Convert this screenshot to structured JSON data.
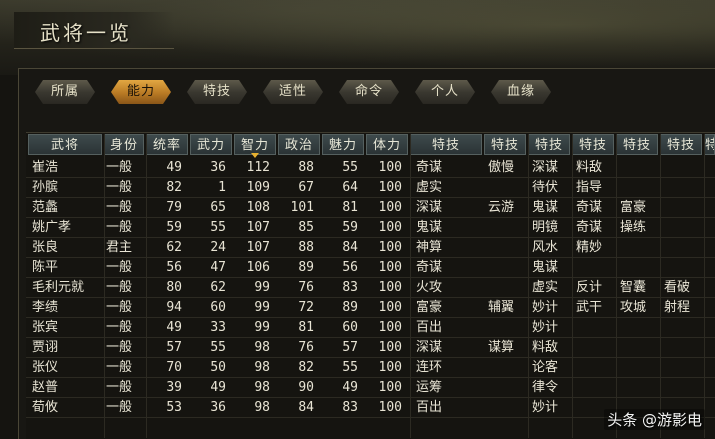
{
  "window": {
    "title": "武将一览"
  },
  "tabs": [
    {
      "label": "所属",
      "active": false
    },
    {
      "label": "能力",
      "active": true
    },
    {
      "label": "特技",
      "active": false
    },
    {
      "label": "适性",
      "active": false
    },
    {
      "label": "命令",
      "active": false
    },
    {
      "label": "个人",
      "active": false
    },
    {
      "label": "血缘",
      "active": false
    }
  ],
  "columns": [
    "武将",
    "身份",
    "统率",
    "武力",
    "智力",
    "政治",
    "魅力",
    "体力",
    "特技",
    "特技",
    "特技",
    "特技",
    "特技",
    "特技",
    "特"
  ],
  "sorted_column": "智力",
  "rows": [
    {
      "name": "崔浩",
      "rank": "一般",
      "lead": "49",
      "war": "36",
      "int": "112",
      "pol": "88",
      "cha": "55",
      "hp": "100",
      "skills": [
        "奇谋",
        "傲慢",
        "深谋",
        "料敌",
        "",
        "",
        ""
      ]
    },
    {
      "name": "孙膑",
      "rank": "一般",
      "lead": "82",
      "war": "1",
      "int": "109",
      "pol": "67",
      "cha": "64",
      "hp": "100",
      "skills": [
        "虚实",
        "",
        "待伏",
        "指导",
        "",
        "",
        ""
      ]
    },
    {
      "name": "范蠡",
      "rank": "一般",
      "lead": "79",
      "war": "65",
      "int": "108",
      "pol": "101",
      "cha": "81",
      "hp": "100",
      "skills": [
        "深谋",
        "云游",
        "鬼谋",
        "奇谋",
        "富豪",
        "",
        ""
      ]
    },
    {
      "name": "姚广孝",
      "rank": "一般",
      "lead": "59",
      "war": "55",
      "int": "107",
      "pol": "85",
      "cha": "59",
      "hp": "100",
      "skills": [
        "鬼谋",
        "",
        "明镜",
        "奇谋",
        "操练",
        "",
        ""
      ]
    },
    {
      "name": "张良",
      "rank": "君主",
      "lead": "62",
      "war": "24",
      "int": "107",
      "pol": "88",
      "cha": "84",
      "hp": "100",
      "skills": [
        "神算",
        "",
        "风水",
        "精妙",
        "",
        "",
        ""
      ]
    },
    {
      "name": "陈平",
      "rank": "一般",
      "lead": "56",
      "war": "47",
      "int": "106",
      "pol": "89",
      "cha": "56",
      "hp": "100",
      "skills": [
        "奇谋",
        "",
        "鬼谋",
        "",
        "",
        "",
        ""
      ]
    },
    {
      "name": "毛利元就",
      "rank": "一般",
      "lead": "80",
      "war": "62",
      "int": "99",
      "pol": "76",
      "cha": "83",
      "hp": "100",
      "skills": [
        "火攻",
        "",
        "虚实",
        "反计",
        "智囊",
        "看破",
        ""
      ]
    },
    {
      "name": "李绩",
      "rank": "一般",
      "lead": "94",
      "war": "60",
      "int": "99",
      "pol": "72",
      "cha": "89",
      "hp": "100",
      "skills": [
        "富豪",
        "辅翼",
        "妙计",
        "武干",
        "攻城",
        "射程",
        ""
      ]
    },
    {
      "name": "张宾",
      "rank": "一般",
      "lead": "49",
      "war": "33",
      "int": "99",
      "pol": "81",
      "cha": "60",
      "hp": "100",
      "skills": [
        "百出",
        "",
        "妙计",
        "",
        "",
        "",
        ""
      ]
    },
    {
      "name": "贾诩",
      "rank": "一般",
      "lead": "57",
      "war": "55",
      "int": "98",
      "pol": "76",
      "cha": "57",
      "hp": "100",
      "skills": [
        "深谋",
        "谋算",
        "料敌",
        "",
        "",
        "",
        ""
      ]
    },
    {
      "name": "张仪",
      "rank": "一般",
      "lead": "70",
      "war": "50",
      "int": "98",
      "pol": "82",
      "cha": "55",
      "hp": "100",
      "skills": [
        "连环",
        "",
        "论客",
        "",
        "",
        "",
        ""
      ]
    },
    {
      "name": "赵普",
      "rank": "一般",
      "lead": "39",
      "war": "49",
      "int": "98",
      "pol": "90",
      "cha": "49",
      "hp": "100",
      "skills": [
        "运筹",
        "",
        "律令",
        "",
        "",
        "",
        ""
      ]
    },
    {
      "name": "荀攸",
      "rank": "一般",
      "lead": "53",
      "war": "36",
      "int": "98",
      "pol": "84",
      "cha": "83",
      "hp": "100",
      "skills": [
        "百出",
        "",
        "妙计",
        "",
        "",
        "",
        ""
      ]
    }
  ],
  "watermark": {
    "text": "头条 @游影电"
  },
  "colors": {
    "active_tab": "#d89a38",
    "header_bg": "#34403f",
    "text": "#e8e4d4",
    "background": "#151410"
  }
}
